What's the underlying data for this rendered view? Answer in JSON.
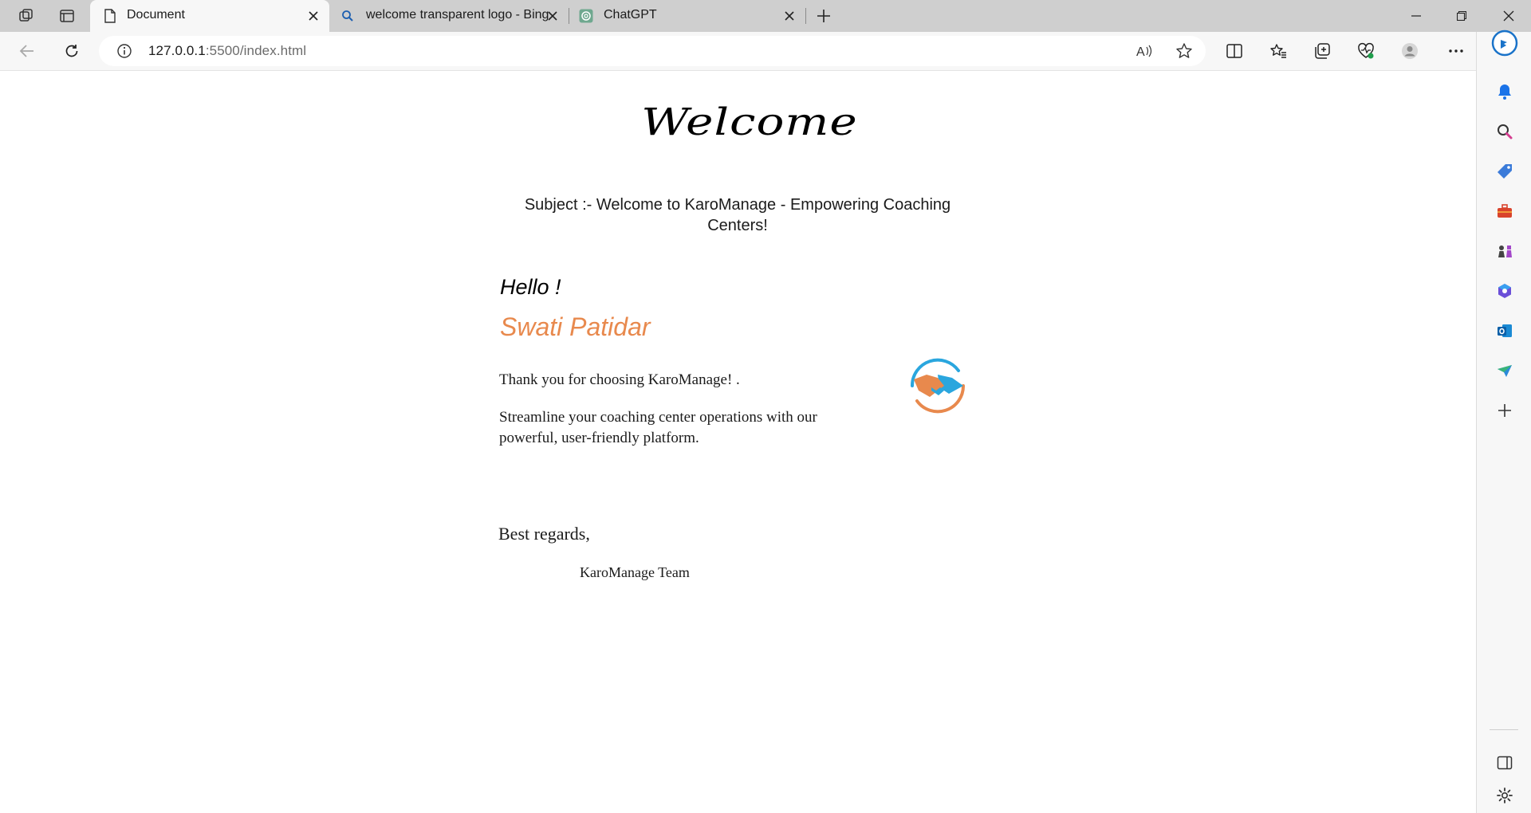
{
  "browser": {
    "tabs": [
      {
        "title": "Document",
        "favicon": "document-icon",
        "active": true
      },
      {
        "title": "welcome transparent logo - Bing",
        "favicon": "bing-search-icon",
        "active": false
      },
      {
        "title": "ChatGPT",
        "favicon": "chatgpt-icon",
        "active": false
      }
    ],
    "address": {
      "host": "127.0.0.1",
      "path": ":5500/index.html"
    }
  },
  "page": {
    "heading": "Welcome",
    "subject": "Subject :- Welcome to KaroManage - Empowering Coaching Centers!",
    "greeting": "Hello !",
    "recipient_name": "Swati Patidar",
    "thanks": "Thank you for choosing KaroManage! .",
    "body": "Streamline your coaching center operations with our powerful, user-friendly platform.",
    "closing": "Best regards,",
    "signature": "KaroManage Team",
    "logo": "handshake-logo",
    "colors": {
      "name_accent": "#e8894d",
      "logo_orange": "#e8894d",
      "logo_blue": "#2aa6de"
    }
  }
}
